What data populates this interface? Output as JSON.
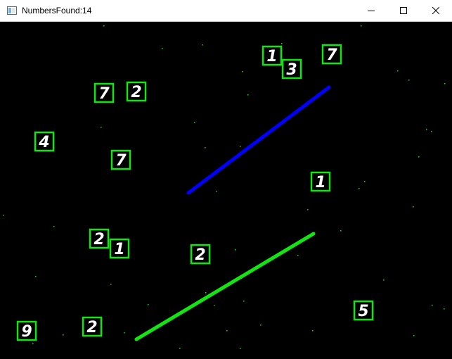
{
  "window": {
    "title": "NumbersFound:14",
    "controls": {
      "minimize": "minimize-icon",
      "maximize": "maximize-icon",
      "close": "close-icon"
    }
  },
  "detection": {
    "box_color": "#14e414",
    "digit_color": "#ffffff",
    "detected_digits": [
      "1",
      "3",
      "7",
      "7",
      "2",
      "4",
      "7",
      "1",
      "2",
      "1",
      "2",
      "9",
      "2",
      "5"
    ],
    "lines": [
      {
        "name": "blue-line",
        "color": "#0000ff"
      },
      {
        "name": "green-line",
        "color": "#14e414"
      }
    ],
    "star_color": "#1fbf1f"
  }
}
